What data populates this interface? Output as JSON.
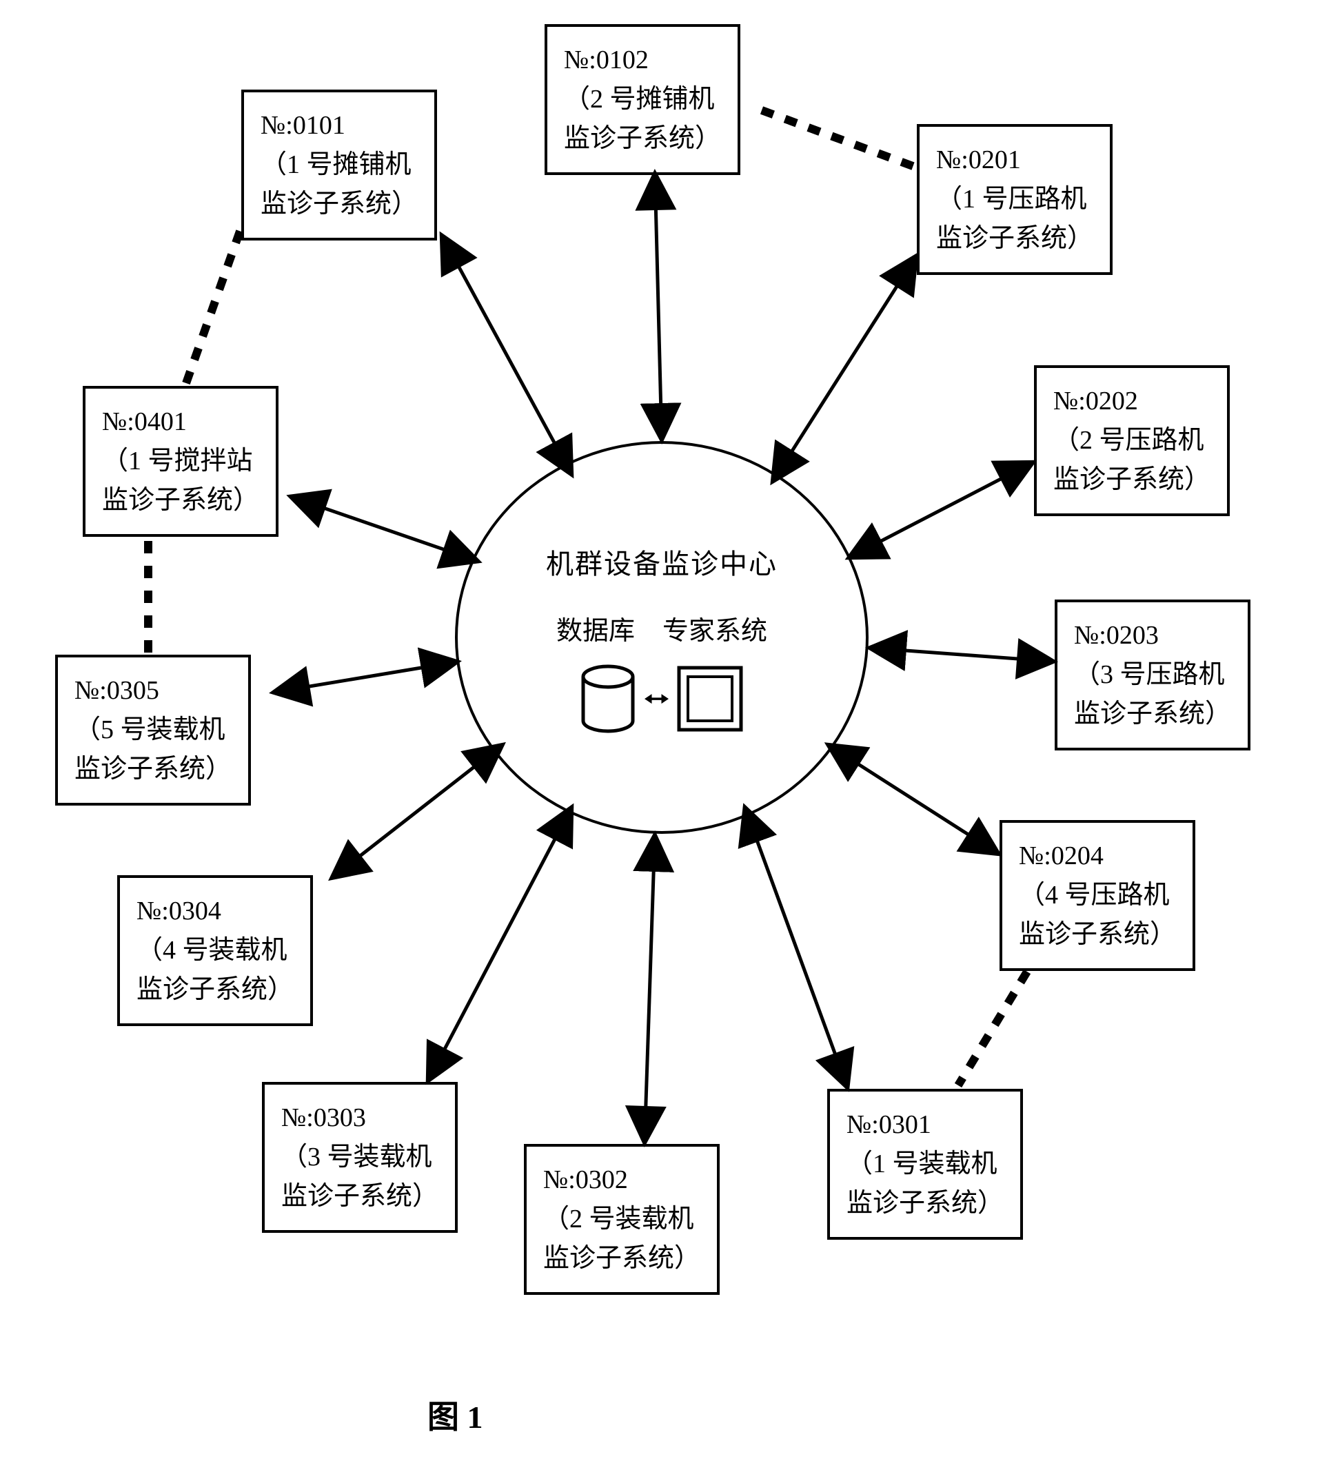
{
  "center": {
    "title": "机群设备监诊中心",
    "db_label": "数据库",
    "expert_label": "专家系统"
  },
  "nodes": {
    "n0101": {
      "code": "№:0101",
      "line2": "（1 号摊铺机",
      "line3": "监诊子系统）"
    },
    "n0102": {
      "code": "№:0102",
      "line2": "（2 号摊铺机",
      "line3": "监诊子系统）"
    },
    "n0201": {
      "code": "№:0201",
      "line2": "（1 号压路机",
      "line3": "监诊子系统）"
    },
    "n0202": {
      "code": "№:0202",
      "line2": "（2 号压路机",
      "line3": "监诊子系统）"
    },
    "n0203": {
      "code": "№:0203",
      "line2": "（3 号压路机",
      "line3": "监诊子系统）"
    },
    "n0204": {
      "code": "№:0204",
      "line2": "（4 号压路机",
      "line3": "监诊子系统）"
    },
    "n0301": {
      "code": "№:0301",
      "line2": "（1 号装载机",
      "line3": "监诊子系统）"
    },
    "n0302": {
      "code": "№:0302",
      "line2": "（2 号装载机",
      "line3": "监诊子系统）"
    },
    "n0303": {
      "code": "№:0303",
      "line2": "（3 号装载机",
      "line3": "监诊子系统）"
    },
    "n0304": {
      "code": "№:0304",
      "line2": "（4 号装载机",
      "line3": "监诊子系统）"
    },
    "n0305": {
      "code": "№:0305",
      "line2": "（5 号装载机",
      "line3": "监诊子系统）"
    },
    "n0401": {
      "code": "№:0401",
      "line2": "（1 号搅拌站",
      "line3": "监诊子系统）"
    }
  },
  "figure_label": "图 1"
}
